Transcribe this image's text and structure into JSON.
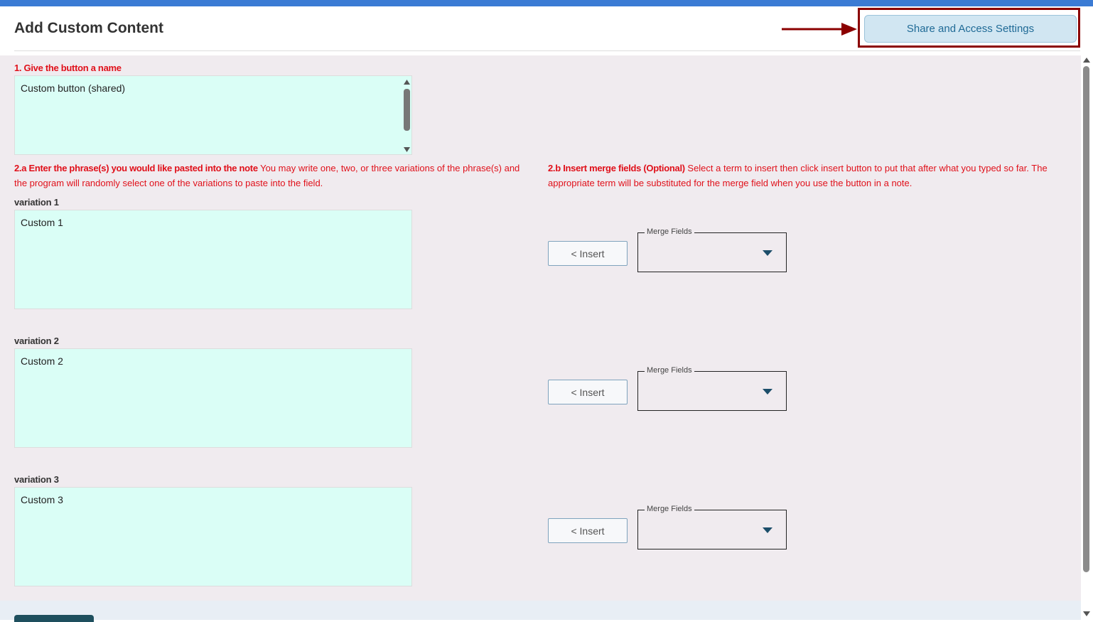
{
  "header": {
    "title": "Add Custom Content",
    "share_button": "Share and Access Settings"
  },
  "section1": {
    "label": "1. Give the button a name",
    "value": "Custom button (shared)"
  },
  "section2a": {
    "label_bold": "2.a Enter the phrase(s) you would like pasted into the note",
    "label_text": " You may write one, two, or three variations of the phrase(s) and the program will randomly select one of the variations to paste into the field."
  },
  "section2b": {
    "label_bold": "2.b Insert merge fields (Optional)",
    "label_text": " Select a term to insert then click insert button to put that after what you typed so far. The appropriate term will be substituted for the merge field when you use the button in a note."
  },
  "variations": [
    {
      "label": "variation 1",
      "value": "Custom 1",
      "insert": "< Insert",
      "merge_label": "Merge Fields",
      "merge_value": ""
    },
    {
      "label": "variation 2",
      "value": "Custom 2",
      "insert": "< Insert",
      "merge_label": "Merge Fields",
      "merge_value": ""
    },
    {
      "label": "variation 3",
      "value": "Custom 3",
      "insert": "< Insert",
      "merge_label": "Merge Fields",
      "merge_value": ""
    }
  ],
  "colors": {
    "accent_bar": "#3b7bd4",
    "required_label": "#e0101a",
    "textarea_bg": "#dafef6",
    "highlight": "#8b0000"
  }
}
